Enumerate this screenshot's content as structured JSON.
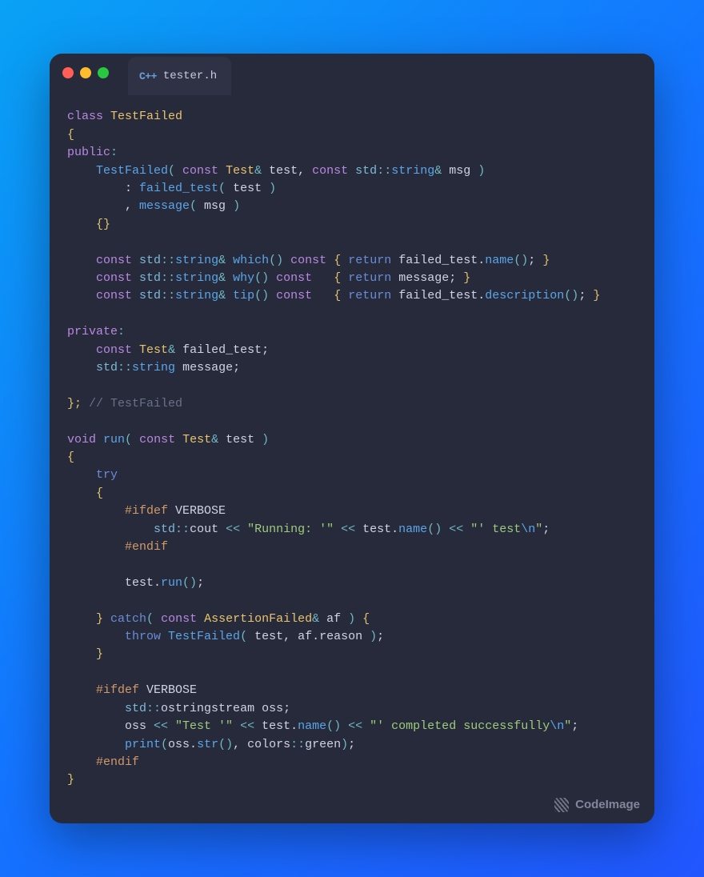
{
  "tab": {
    "filename": "tester.h",
    "lang_icon_label": "C++"
  },
  "watermark": "CodeImage",
  "code": {
    "tokens": [
      [
        [
          "class",
          "kw"
        ],
        [
          " ",
          "plain"
        ],
        [
          "TestFailed",
          "type"
        ]
      ],
      [
        [
          "{",
          "punct"
        ]
      ],
      [
        [
          "public",
          "kw"
        ],
        [
          ":",
          "op"
        ]
      ],
      [
        [
          "    TestFailed",
          "fn"
        ],
        [
          "( ",
          "op"
        ],
        [
          "const",
          "kw"
        ],
        [
          " ",
          "plain"
        ],
        [
          "Test",
          "type"
        ],
        [
          "& ",
          "op"
        ],
        [
          "test",
          "plain"
        ],
        [
          ", ",
          "plain"
        ],
        [
          "const",
          "kw"
        ],
        [
          " ",
          "plain"
        ],
        [
          "std",
          "ns"
        ],
        [
          "::",
          "op"
        ],
        [
          "string",
          "fn"
        ],
        [
          "& ",
          "op"
        ],
        [
          "msg ",
          "plain"
        ],
        [
          ")",
          "op"
        ]
      ],
      [
        [
          "        : ",
          "plain"
        ],
        [
          "failed_test",
          "fn"
        ],
        [
          "( ",
          "op"
        ],
        [
          "test ",
          "plain"
        ],
        [
          ")",
          "op"
        ]
      ],
      [
        [
          "        , ",
          "plain"
        ],
        [
          "message",
          "fn"
        ],
        [
          "( ",
          "op"
        ],
        [
          "msg ",
          "plain"
        ],
        [
          ")",
          "op"
        ]
      ],
      [
        [
          "    {}",
          "punct"
        ]
      ],
      [
        [
          "",
          "plain"
        ]
      ],
      [
        [
          "    ",
          "plain"
        ],
        [
          "const",
          "kw"
        ],
        [
          " ",
          "plain"
        ],
        [
          "std",
          "ns"
        ],
        [
          "::",
          "op"
        ],
        [
          "string",
          "fn"
        ],
        [
          "& ",
          "op"
        ],
        [
          "which",
          "fn"
        ],
        [
          "()",
          "op"
        ],
        [
          " ",
          "plain"
        ],
        [
          "const",
          "kw"
        ],
        [
          " ",
          "plain"
        ],
        [
          "{ ",
          "punct"
        ],
        [
          "return",
          "ctrl"
        ],
        [
          " ",
          "plain"
        ],
        [
          "failed_test.",
          "plain"
        ],
        [
          "name",
          "fn"
        ],
        [
          "()",
          "op"
        ],
        [
          "; ",
          "plain"
        ],
        [
          "}",
          "punct"
        ]
      ],
      [
        [
          "    ",
          "plain"
        ],
        [
          "const",
          "kw"
        ],
        [
          " ",
          "plain"
        ],
        [
          "std",
          "ns"
        ],
        [
          "::",
          "op"
        ],
        [
          "string",
          "fn"
        ],
        [
          "& ",
          "op"
        ],
        [
          "why",
          "fn"
        ],
        [
          "()",
          "op"
        ],
        [
          " ",
          "plain"
        ],
        [
          "const",
          "kw"
        ],
        [
          "   ",
          "plain"
        ],
        [
          "{ ",
          "punct"
        ],
        [
          "return",
          "ctrl"
        ],
        [
          " ",
          "plain"
        ],
        [
          "message; ",
          "plain"
        ],
        [
          "}",
          "punct"
        ]
      ],
      [
        [
          "    ",
          "plain"
        ],
        [
          "const",
          "kw"
        ],
        [
          " ",
          "plain"
        ],
        [
          "std",
          "ns"
        ],
        [
          "::",
          "op"
        ],
        [
          "string",
          "fn"
        ],
        [
          "& ",
          "op"
        ],
        [
          "tip",
          "fn"
        ],
        [
          "()",
          "op"
        ],
        [
          " ",
          "plain"
        ],
        [
          "const",
          "kw"
        ],
        [
          "   ",
          "plain"
        ],
        [
          "{ ",
          "punct"
        ],
        [
          "return",
          "ctrl"
        ],
        [
          " ",
          "plain"
        ],
        [
          "failed_test.",
          "plain"
        ],
        [
          "description",
          "fn"
        ],
        [
          "()",
          "op"
        ],
        [
          "; ",
          "plain"
        ],
        [
          "}",
          "punct"
        ]
      ],
      [
        [
          "",
          "plain"
        ]
      ],
      [
        [
          "private",
          "kw"
        ],
        [
          ":",
          "op"
        ]
      ],
      [
        [
          "    ",
          "plain"
        ],
        [
          "const",
          "kw"
        ],
        [
          " ",
          "plain"
        ],
        [
          "Test",
          "type"
        ],
        [
          "& ",
          "op"
        ],
        [
          "failed_test;",
          "plain"
        ]
      ],
      [
        [
          "    ",
          "plain"
        ],
        [
          "std",
          "ns"
        ],
        [
          "::",
          "op"
        ],
        [
          "string",
          "fn"
        ],
        [
          " ",
          "plain"
        ],
        [
          "message;",
          "plain"
        ]
      ],
      [
        [
          "",
          "plain"
        ]
      ],
      [
        [
          "}; ",
          "punct"
        ],
        [
          "// TestFailed",
          "cmt"
        ]
      ],
      [
        [
          "",
          "plain"
        ]
      ],
      [
        [
          "void",
          "kw"
        ],
        [
          " ",
          "plain"
        ],
        [
          "run",
          "fn"
        ],
        [
          "( ",
          "op"
        ],
        [
          "const",
          "kw"
        ],
        [
          " ",
          "plain"
        ],
        [
          "Test",
          "type"
        ],
        [
          "& ",
          "op"
        ],
        [
          "test ",
          "plain"
        ],
        [
          ")",
          "op"
        ]
      ],
      [
        [
          "{",
          "punct"
        ]
      ],
      [
        [
          "    ",
          "plain"
        ],
        [
          "try",
          "ctrl"
        ]
      ],
      [
        [
          "    ",
          "plain"
        ],
        [
          "{",
          "punct"
        ]
      ],
      [
        [
          "        ",
          "plain"
        ],
        [
          "#ifdef",
          "pre"
        ],
        [
          " ",
          "plain"
        ],
        [
          "VERBOSE",
          "plain"
        ]
      ],
      [
        [
          "            ",
          "plain"
        ],
        [
          "std",
          "ns"
        ],
        [
          "::",
          "op"
        ],
        [
          "cout ",
          "plain"
        ],
        [
          "<< ",
          "op"
        ],
        [
          "\"Running: '\"",
          "str"
        ],
        [
          " ",
          "plain"
        ],
        [
          "<< ",
          "op"
        ],
        [
          "test.",
          "plain"
        ],
        [
          "name",
          "fn"
        ],
        [
          "()",
          "op"
        ],
        [
          " ",
          "plain"
        ],
        [
          "<< ",
          "op"
        ],
        [
          "\"' test",
          "str"
        ],
        [
          "\\n",
          "esc"
        ],
        [
          "\"",
          "str"
        ],
        [
          ";",
          "plain"
        ]
      ],
      [
        [
          "        ",
          "plain"
        ],
        [
          "#endif",
          "pre"
        ]
      ],
      [
        [
          "",
          "plain"
        ]
      ],
      [
        [
          "        test.",
          "plain"
        ],
        [
          "run",
          "fn"
        ],
        [
          "()",
          "op"
        ],
        [
          ";",
          "plain"
        ]
      ],
      [
        [
          "",
          "plain"
        ]
      ],
      [
        [
          "    ",
          "plain"
        ],
        [
          "} ",
          "punct"
        ],
        [
          "catch",
          "ctrl"
        ],
        [
          "( ",
          "op"
        ],
        [
          "const",
          "kw"
        ],
        [
          " ",
          "plain"
        ],
        [
          "AssertionFailed",
          "type"
        ],
        [
          "& ",
          "op"
        ],
        [
          "af ",
          "plain"
        ],
        [
          ") ",
          "op"
        ],
        [
          "{",
          "punct"
        ]
      ],
      [
        [
          "        ",
          "plain"
        ],
        [
          "throw",
          "ctrl"
        ],
        [
          " ",
          "plain"
        ],
        [
          "TestFailed",
          "fn"
        ],
        [
          "( ",
          "op"
        ],
        [
          "test, af.reason ",
          "plain"
        ],
        [
          ")",
          "op"
        ],
        [
          ";",
          "plain"
        ]
      ],
      [
        [
          "    ",
          "plain"
        ],
        [
          "}",
          "punct"
        ]
      ],
      [
        [
          "",
          "plain"
        ]
      ],
      [
        [
          "    ",
          "plain"
        ],
        [
          "#ifdef",
          "pre"
        ],
        [
          " ",
          "plain"
        ],
        [
          "VERBOSE",
          "plain"
        ]
      ],
      [
        [
          "        ",
          "plain"
        ],
        [
          "std",
          "ns"
        ],
        [
          "::",
          "op"
        ],
        [
          "ostringstream ",
          "plain"
        ],
        [
          "oss;",
          "plain"
        ]
      ],
      [
        [
          "        oss ",
          "plain"
        ],
        [
          "<< ",
          "op"
        ],
        [
          "\"Test '\"",
          "str"
        ],
        [
          " ",
          "plain"
        ],
        [
          "<< ",
          "op"
        ],
        [
          "test.",
          "plain"
        ],
        [
          "name",
          "fn"
        ],
        [
          "()",
          "op"
        ],
        [
          " ",
          "plain"
        ],
        [
          "<< ",
          "op"
        ],
        [
          "\"' completed successfully",
          "str"
        ],
        [
          "\\n",
          "esc"
        ],
        [
          "\"",
          "str"
        ],
        [
          ";",
          "plain"
        ]
      ],
      [
        [
          "        ",
          "plain"
        ],
        [
          "print",
          "fn"
        ],
        [
          "(",
          "op"
        ],
        [
          "oss.",
          "plain"
        ],
        [
          "str",
          "fn"
        ],
        [
          "()",
          "op"
        ],
        [
          ", ",
          "plain"
        ],
        [
          "colors",
          "plain"
        ],
        [
          "::",
          "op"
        ],
        [
          "green",
          "plain"
        ],
        [
          ")",
          "op"
        ],
        [
          ";",
          "plain"
        ]
      ],
      [
        [
          "    ",
          "plain"
        ],
        [
          "#endif",
          "pre"
        ]
      ],
      [
        [
          "}",
          "punct"
        ]
      ]
    ]
  }
}
